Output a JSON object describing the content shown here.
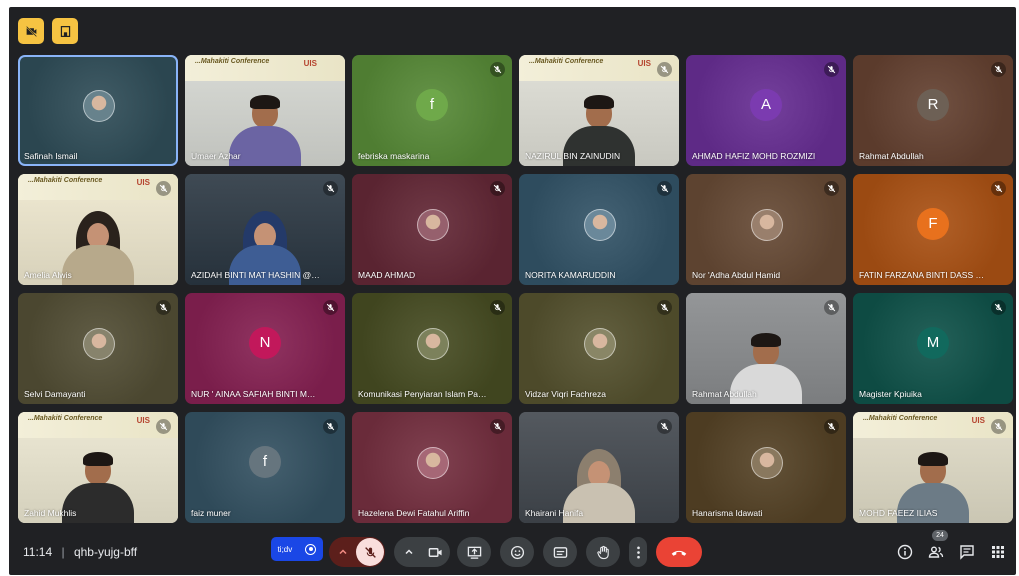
{
  "meeting": {
    "time": "11:14",
    "separator": "|",
    "code": "qhb-yujg-bff",
    "participant_count": "24",
    "present_chip_label": "ti;dv"
  },
  "colors": {
    "background": "#202124",
    "end_call": "#ea4335",
    "accent_yellow": "#f6c342",
    "present_blue": "#1a47e6"
  },
  "banner": {
    "text": "...Mahakiti Conference",
    "logo": "UIS"
  },
  "tiles": [
    {
      "name": "Safinah Ismail",
      "kind": "photo",
      "bg": "#2b4650",
      "muted": false,
      "speaking": true
    },
    {
      "name": "Umaer Azhar",
      "kind": "video",
      "bg": "#cfd1cc",
      "muted": false
    },
    {
      "name": "febriska maskarina",
      "kind": "letter",
      "letter": "f",
      "bg": "#4f7d32",
      "avatar": "#6fa94a",
      "muted": true
    },
    {
      "name": "NAZIRUL BIN ZAINUDIN",
      "kind": "video",
      "bg": "#d7d7cf",
      "muted": true
    },
    {
      "name": "AHMAD HAFIZ MOHD ROZMIZI",
      "kind": "letter",
      "letter": "A",
      "bg": "#5e2a86",
      "avatar": "#7b3bb0",
      "muted": true
    },
    {
      "name": "Rahmat Abdullah",
      "kind": "letter",
      "letter": "R",
      "bg": "#5b3b2c",
      "avatar": "#6d6055",
      "muted": true
    },
    {
      "name": "Amelia Alwis",
      "kind": "video",
      "bg": "#e6e0c9",
      "muted": true
    },
    {
      "name": "AZIDAH BINTI MAT HASHIN @ HAR...",
      "kind": "video",
      "bg": "#35404a",
      "muted": true
    },
    {
      "name": "MAAD AHMAD",
      "kind": "photo",
      "bg": "#5a2431",
      "muted": true
    },
    {
      "name": "NORITA KAMARUDDIN",
      "kind": "photo",
      "bg": "#2e4c5e",
      "muted": true
    },
    {
      "name": "Nor 'Adha Abdul Hamid",
      "kind": "photo",
      "bg": "#5d4330",
      "muted": true
    },
    {
      "name": "FATIN FARZANA BINTI DASS MERAL",
      "kind": "letter",
      "letter": "F",
      "bg": "#9b4a12",
      "avatar": "#e8711d",
      "muted": true
    },
    {
      "name": "Selvi Damayanti",
      "kind": "photo",
      "bg": "#4b4730",
      "muted": true
    },
    {
      "name": "NUR ' AINAA SAFIAH BINTI MOHD F...",
      "kind": "letter",
      "letter": "N",
      "bg": "#7a1e4b",
      "avatar": "#c2185b",
      "muted": true
    },
    {
      "name": "Komunikasi Penyiaran Islam Pascas...",
      "kind": "photo",
      "bg": "#40451f",
      "muted": true
    },
    {
      "name": "Vidzar Viqri Fachreza",
      "kind": "photo",
      "bg": "#4d4a2a",
      "muted": true
    },
    {
      "name": "Rahmat Abdullah",
      "kind": "video",
      "bg": "#8a8c8e",
      "muted": true
    },
    {
      "name": "Magister Kpiuika",
      "kind": "letter",
      "letter": "M",
      "bg": "#0e4b43",
      "avatar": "#11695d",
      "muted": true
    },
    {
      "name": "Zahid Mukhlis",
      "kind": "video",
      "bg": "#e3dfcb",
      "muted": true
    },
    {
      "name": "faiz muner",
      "kind": "letter",
      "letter": "f",
      "bg": "#2f4a59",
      "avatar": "#66757e",
      "muted": true
    },
    {
      "name": "Hazelena Dewi Fatahul Ariffin",
      "kind": "photo",
      "bg": "#6a2b3a",
      "muted": true
    },
    {
      "name": "Khairani Hanifa",
      "kind": "video",
      "bg": "#4a4f55",
      "muted": true
    },
    {
      "name": "Hanarisma Idawati",
      "kind": "photo",
      "bg": "#4d3c22",
      "muted": true
    },
    {
      "name": "MOHD FAEEZ ILIAS",
      "kind": "video",
      "bg": "#d9d5c2",
      "muted": true
    }
  ],
  "icons": {
    "top_left_1": "camera-off-icon",
    "top_left_2": "building-icon",
    "controls": [
      "chevron-up-icon",
      "mic-off-icon",
      "chevron-up-icon",
      "camera-icon",
      "present-screen-icon",
      "emoji-icon",
      "captions-icon",
      "raise-hand-icon",
      "more-vert-icon",
      "end-call-icon"
    ],
    "right": [
      "info-icon",
      "people-icon",
      "chat-icon",
      "apps-icon"
    ]
  }
}
